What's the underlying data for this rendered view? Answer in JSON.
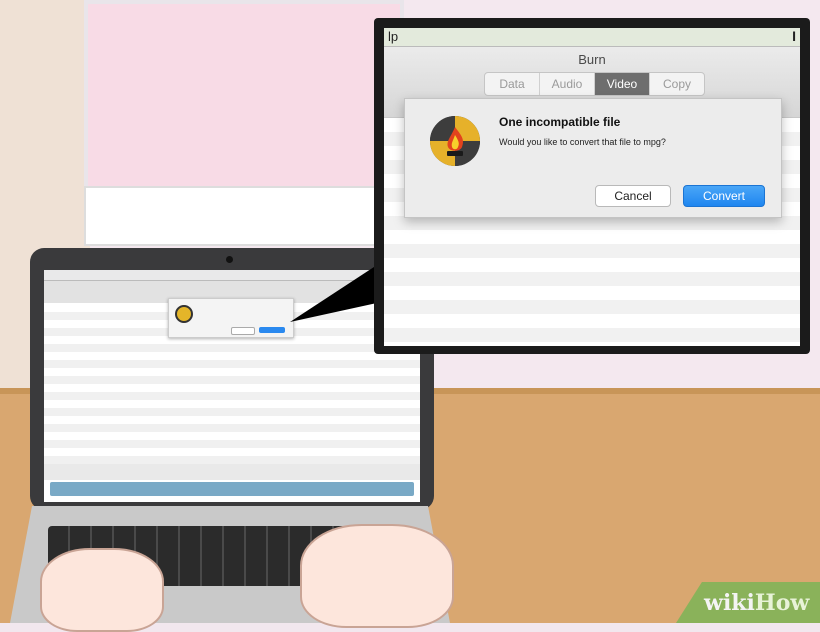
{
  "menubar": {
    "help_fragment": "lp",
    "edge_glyph": "I"
  },
  "window": {
    "title": "Burn"
  },
  "tabs": [
    {
      "label": "Data",
      "active": false
    },
    {
      "label": "Audio",
      "active": false
    },
    {
      "label": "Video",
      "active": true
    },
    {
      "label": "Copy",
      "active": false
    }
  ],
  "dialog": {
    "icon": "burn-app-icon",
    "title": "One incompatible file",
    "message": "Would you like to convert that file to mpg?",
    "cancel_label": "Cancel",
    "convert_label": "Convert"
  },
  "watermark": {
    "part1": "wiki",
    "part2": "How"
  },
  "colors": {
    "accent": "#1f86f0",
    "tab_active": "#6e6e6e"
  }
}
